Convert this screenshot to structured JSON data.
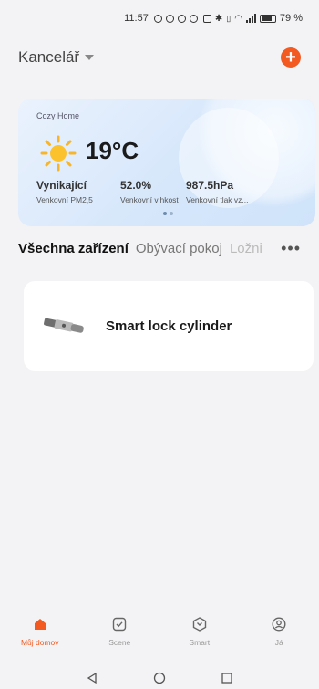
{
  "status_bar": {
    "time": "11:57",
    "battery": "79 %"
  },
  "header": {
    "home_name": "Kancelář"
  },
  "weather": {
    "home_label": "Cozy Home",
    "temperature": "19°C",
    "metrics": [
      {
        "value": "Vynikající",
        "label": "Venkovní PM2,5"
      },
      {
        "value": "52.0%",
        "label": "Venkovní vlhkost"
      },
      {
        "value": "987.5hPa",
        "label": "Venkovní tlak vz..."
      }
    ]
  },
  "tabs": [
    "Všechna zařízení",
    "Obývací pokoj",
    "Ložni"
  ],
  "devices": [
    {
      "name": "Smart lock cylinder"
    }
  ],
  "bottom_nav": [
    {
      "label": "Můj domov",
      "icon": "home-icon",
      "active": true
    },
    {
      "label": "Scene",
      "icon": "scene-icon",
      "active": false
    },
    {
      "label": "Smart",
      "icon": "smart-icon",
      "active": false
    },
    {
      "label": "Já",
      "icon": "profile-icon",
      "active": false
    }
  ],
  "colors": {
    "accent": "#f25a22",
    "background": "#f3f3f5",
    "card": "#ffffff"
  }
}
